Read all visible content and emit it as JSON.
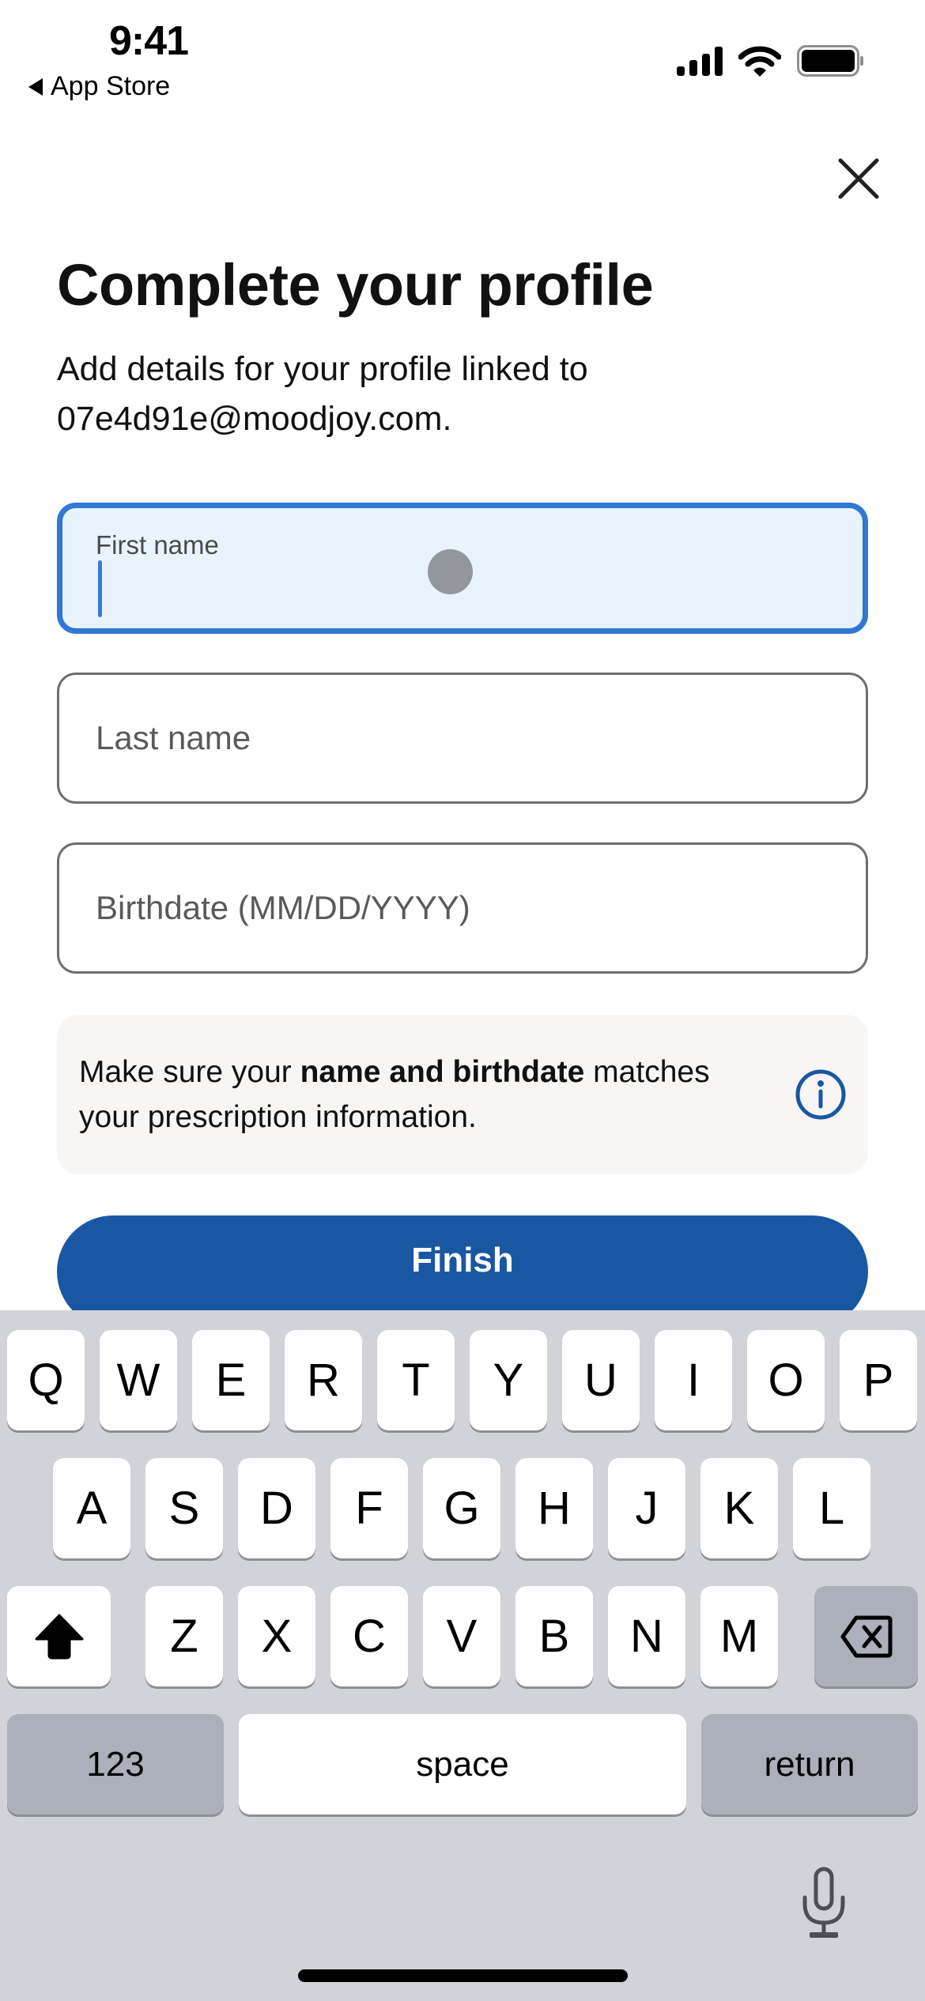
{
  "status_bar": {
    "time": "9:41",
    "back_app_label": "App Store",
    "icons": [
      "cellular-signal-icon",
      "wifi-icon",
      "battery-icon"
    ]
  },
  "header": {
    "close_icon": "close-icon"
  },
  "page": {
    "title": "Complete your profile",
    "subtitle": "Add details for your profile linked to 07e4d91e@moodjoy.com."
  },
  "form": {
    "first_name": {
      "label": "First name",
      "value": "",
      "focused": true
    },
    "last_name": {
      "placeholder": "Last name",
      "value": ""
    },
    "birthdate": {
      "placeholder": "Birthdate (MM/DD/YYYY)",
      "value": ""
    }
  },
  "info": {
    "text_before": "Make sure your ",
    "text_bold": "name and birthdate",
    "text_after": " matches your prescription information.",
    "icon": "info-icon"
  },
  "actions": {
    "finish_label": "Finish"
  },
  "colors": {
    "primary": "#1a57a2",
    "focus_border": "#2f78d6",
    "focus_fill": "#e8f3fd",
    "info_bg": "#f7f6f5",
    "keyboard_bg": "#d1d3d9"
  },
  "keyboard": {
    "row1": [
      "Q",
      "W",
      "E",
      "R",
      "T",
      "Y",
      "U",
      "I",
      "O",
      "P"
    ],
    "row2": [
      "A",
      "S",
      "D",
      "F",
      "G",
      "H",
      "J",
      "K",
      "L"
    ],
    "row3": [
      "Z",
      "X",
      "C",
      "V",
      "B",
      "N",
      "M"
    ],
    "shift_icon": "shift-icon",
    "delete_icon": "delete-icon",
    "numbers_label": "123",
    "space_label": "space",
    "return_label": "return",
    "mic_icon": "microphone-icon"
  }
}
